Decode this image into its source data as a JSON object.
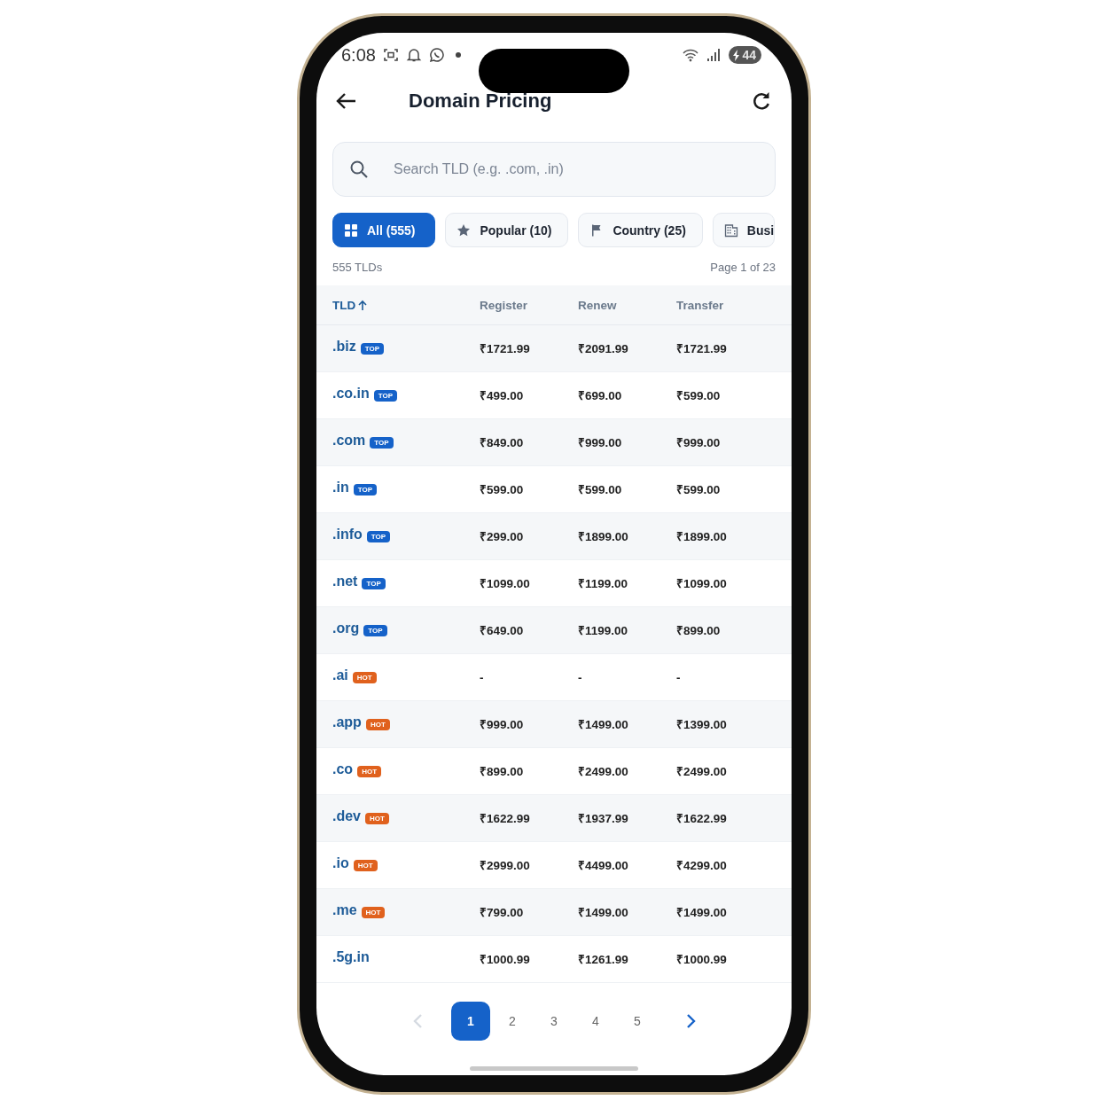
{
  "status_bar": {
    "time": "6:08",
    "battery": "44"
  },
  "header": {
    "title": "Domain Pricing"
  },
  "search": {
    "placeholder": "Search TLD (e.g. .com, .in)"
  },
  "filters": [
    {
      "label": "All (555)",
      "kind": "grid",
      "selected": true
    },
    {
      "label": "Popular (10)",
      "kind": "star",
      "selected": false
    },
    {
      "label": "Country (25)",
      "kind": "flag",
      "selected": false
    },
    {
      "label": "Busi",
      "kind": "building",
      "selected": false
    }
  ],
  "summary": {
    "count": "555 TLDs",
    "page": "Page 1 of 23"
  },
  "table": {
    "columns": [
      "TLD",
      "Register",
      "Renew",
      "Transfer"
    ],
    "rows": [
      {
        "tld": ".biz",
        "badge": {
          "text": "TOP",
          "kind": "top"
        },
        "register": "₹1721.99",
        "renew": "₹2091.99",
        "transfer": "₹1721.99"
      },
      {
        "tld": ".co.in",
        "badge": {
          "text": "TOP",
          "kind": "top"
        },
        "register": "₹499.00",
        "renew": "₹699.00",
        "transfer": "₹599.00"
      },
      {
        "tld": ".com",
        "badge": {
          "text": "TOP",
          "kind": "top"
        },
        "register": "₹849.00",
        "renew": "₹999.00",
        "transfer": "₹999.00"
      },
      {
        "tld": ".in",
        "badge": {
          "text": "TOP",
          "kind": "top"
        },
        "register": "₹599.00",
        "renew": "₹599.00",
        "transfer": "₹599.00"
      },
      {
        "tld": ".info",
        "badge": {
          "text": "TOP",
          "kind": "top"
        },
        "register": "₹299.00",
        "renew": "₹1899.00",
        "transfer": "₹1899.00"
      },
      {
        "tld": ".net",
        "badge": {
          "text": "TOP",
          "kind": "top"
        },
        "register": "₹1099.00",
        "renew": "₹1199.00",
        "transfer": "₹1099.00"
      },
      {
        "tld": ".org",
        "badge": {
          "text": "TOP",
          "kind": "top"
        },
        "register": "₹649.00",
        "renew": "₹1199.00",
        "transfer": "₹899.00"
      },
      {
        "tld": ".ai",
        "badge": {
          "text": "HOT",
          "kind": "hot"
        },
        "register": "-",
        "renew": "-",
        "transfer": "-"
      },
      {
        "tld": ".app",
        "badge": {
          "text": "HOT",
          "kind": "hot"
        },
        "register": "₹999.00",
        "renew": "₹1499.00",
        "transfer": "₹1399.00"
      },
      {
        "tld": ".co",
        "badge": {
          "text": "HOT",
          "kind": "hot"
        },
        "register": "₹899.00",
        "renew": "₹2499.00",
        "transfer": "₹2499.00"
      },
      {
        "tld": ".dev",
        "badge": {
          "text": "HOT",
          "kind": "hot"
        },
        "register": "₹1622.99",
        "renew": "₹1937.99",
        "transfer": "₹1622.99"
      },
      {
        "tld": ".io",
        "badge": {
          "text": "HOT",
          "kind": "hot"
        },
        "register": "₹2999.00",
        "renew": "₹4499.00",
        "transfer": "₹4299.00"
      },
      {
        "tld": ".me",
        "badge": {
          "text": "HOT",
          "kind": "hot"
        },
        "register": "₹799.00",
        "renew": "₹1499.00",
        "transfer": "₹1499.00"
      },
      {
        "tld": ".5g.in",
        "register": "₹1000.99",
        "renew": "₹1261.99",
        "transfer": "₹1000.99"
      }
    ]
  },
  "pagination": {
    "previous": {
      "disabled": true
    },
    "next": {
      "disabled": false
    },
    "pages": [
      {
        "label": "1",
        "selected": true
      },
      {
        "label": "2",
        "selected": false
      },
      {
        "label": "3",
        "selected": false
      },
      {
        "label": "4",
        "selected": false
      },
      {
        "label": "5",
        "selected": false
      }
    ]
  }
}
